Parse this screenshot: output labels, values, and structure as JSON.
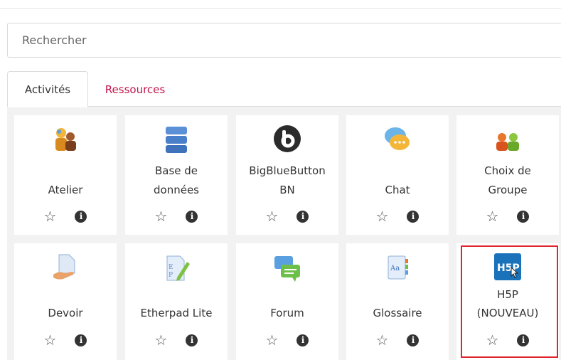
{
  "search": {
    "placeholder": "Rechercher",
    "value": ""
  },
  "tabs": [
    {
      "label": "Activités",
      "active": true
    },
    {
      "label": "Ressources",
      "active": false
    }
  ],
  "activities": [
    {
      "icon": "workshop-icon",
      "lines": [
        "Atelier"
      ]
    },
    {
      "icon": "database-icon",
      "lines": [
        "Base de",
        "données"
      ]
    },
    {
      "icon": "bigbluebutton-icon",
      "lines": [
        "BigBlueButton",
        "BN"
      ]
    },
    {
      "icon": "chat-icon",
      "lines": [
        "Chat"
      ]
    },
    {
      "icon": "group-choice-icon",
      "lines": [
        "Choix de",
        "Groupe"
      ]
    },
    {
      "icon": "assignment-icon",
      "lines": [
        "Devoir"
      ]
    },
    {
      "icon": "etherpad-icon",
      "lines": [
        "Etherpad Lite"
      ]
    },
    {
      "icon": "forum-icon",
      "lines": [
        "Forum"
      ]
    },
    {
      "icon": "glossary-icon",
      "lines": [
        "Glossaire"
      ]
    },
    {
      "icon": "h5p-icon",
      "lines": [
        "H5P",
        "(NOUVEAU)"
      ],
      "badge": "H5P"
    }
  ],
  "colors": {
    "accent": "#c1174d",
    "highlight": "#e0242c",
    "h5p_blue": "#1a73ba"
  }
}
